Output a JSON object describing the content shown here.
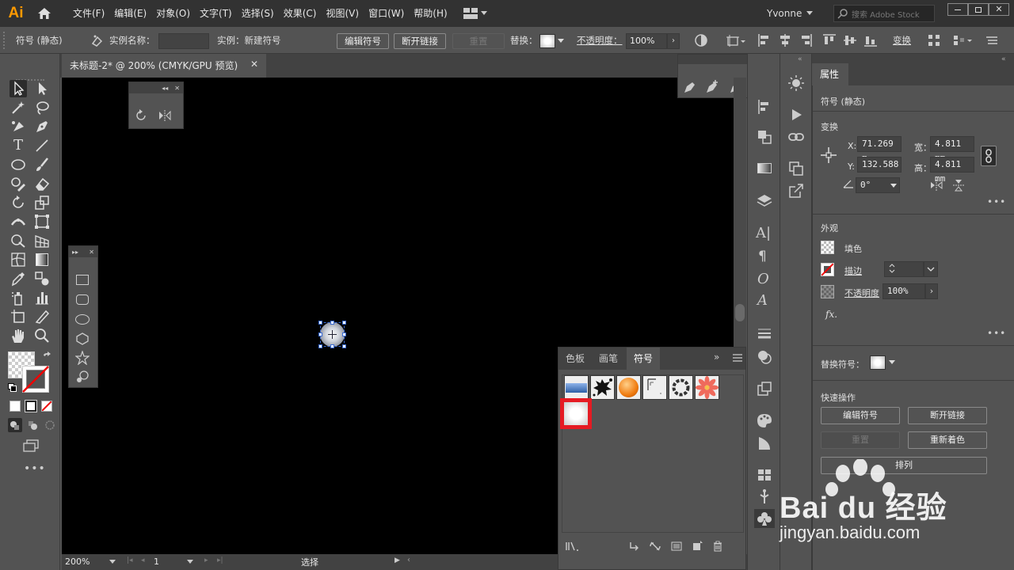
{
  "app": {
    "logo": "Ai"
  },
  "menu": [
    "文件(F)",
    "编辑(E)",
    "对象(O)",
    "文字(T)",
    "选择(S)",
    "效果(C)",
    "视图(V)",
    "窗口(W)",
    "帮助(H)"
  ],
  "user": {
    "name": "Yvonne",
    "search_placeholder": "搜索 Adobe Stock"
  },
  "control": {
    "selection_type": "符号 (静态)",
    "instance_name_label": "实例名称：",
    "instance_label": "实例：新建符号",
    "edit_symbol": "编辑符号",
    "break_link": "断开链接",
    "reset": "重置",
    "replace_label": "替换：",
    "opacity_label": "不透明度：",
    "opacity_value": "100%",
    "transform": "变换"
  },
  "document": {
    "tab_title": "未标题-2* @ 200% (CMYK/GPU 预览)"
  },
  "status": {
    "zoom": "200%",
    "artboard": "1",
    "tool": "选择"
  },
  "symbols_panel": {
    "tabs": [
      "色板",
      "画笔",
      "符号"
    ],
    "active_tab": "符号",
    "symbols": [
      "blue-banner-symbol",
      "ink-splat-symbol",
      "orange-ball-symbol",
      "frame-corner-symbol",
      "ring-symbol",
      "flower-symbol",
      "new-symbol"
    ],
    "selected_symbol": "new-symbol"
  },
  "properties": {
    "tab": "属性",
    "type": "符号 (静态)",
    "transform_title": "变换",
    "x_label": "X:",
    "x_value": "71.269 m",
    "y_label": "Y:",
    "y_value": "132.588",
    "w_label": "宽：",
    "w_value": "4.811 mm",
    "h_label": "高：",
    "h_value": "4.811 mm",
    "angle_value": "0°",
    "appearance_title": "外观",
    "fill_label": "填色",
    "stroke_label": "描边",
    "opacity_label": "不透明度",
    "opacity_value": "100%",
    "fx_label": "fx.",
    "replace_symbol_label": "替换符号：",
    "quick_actions_title": "快速操作",
    "edit_symbol": "编辑符号",
    "break_link": "断开链接",
    "reset": "重置",
    "recolor": "重新着色",
    "arrange": "排列"
  },
  "watermark": {
    "brand": "Bai du 经验",
    "url": "jingyan.baidu.com"
  },
  "colors": {
    "accent": "#ff9a00",
    "selection": "#ff0000",
    "ui_dark": "#323232",
    "ui_panel": "#535353",
    "canvas": "#000000"
  }
}
